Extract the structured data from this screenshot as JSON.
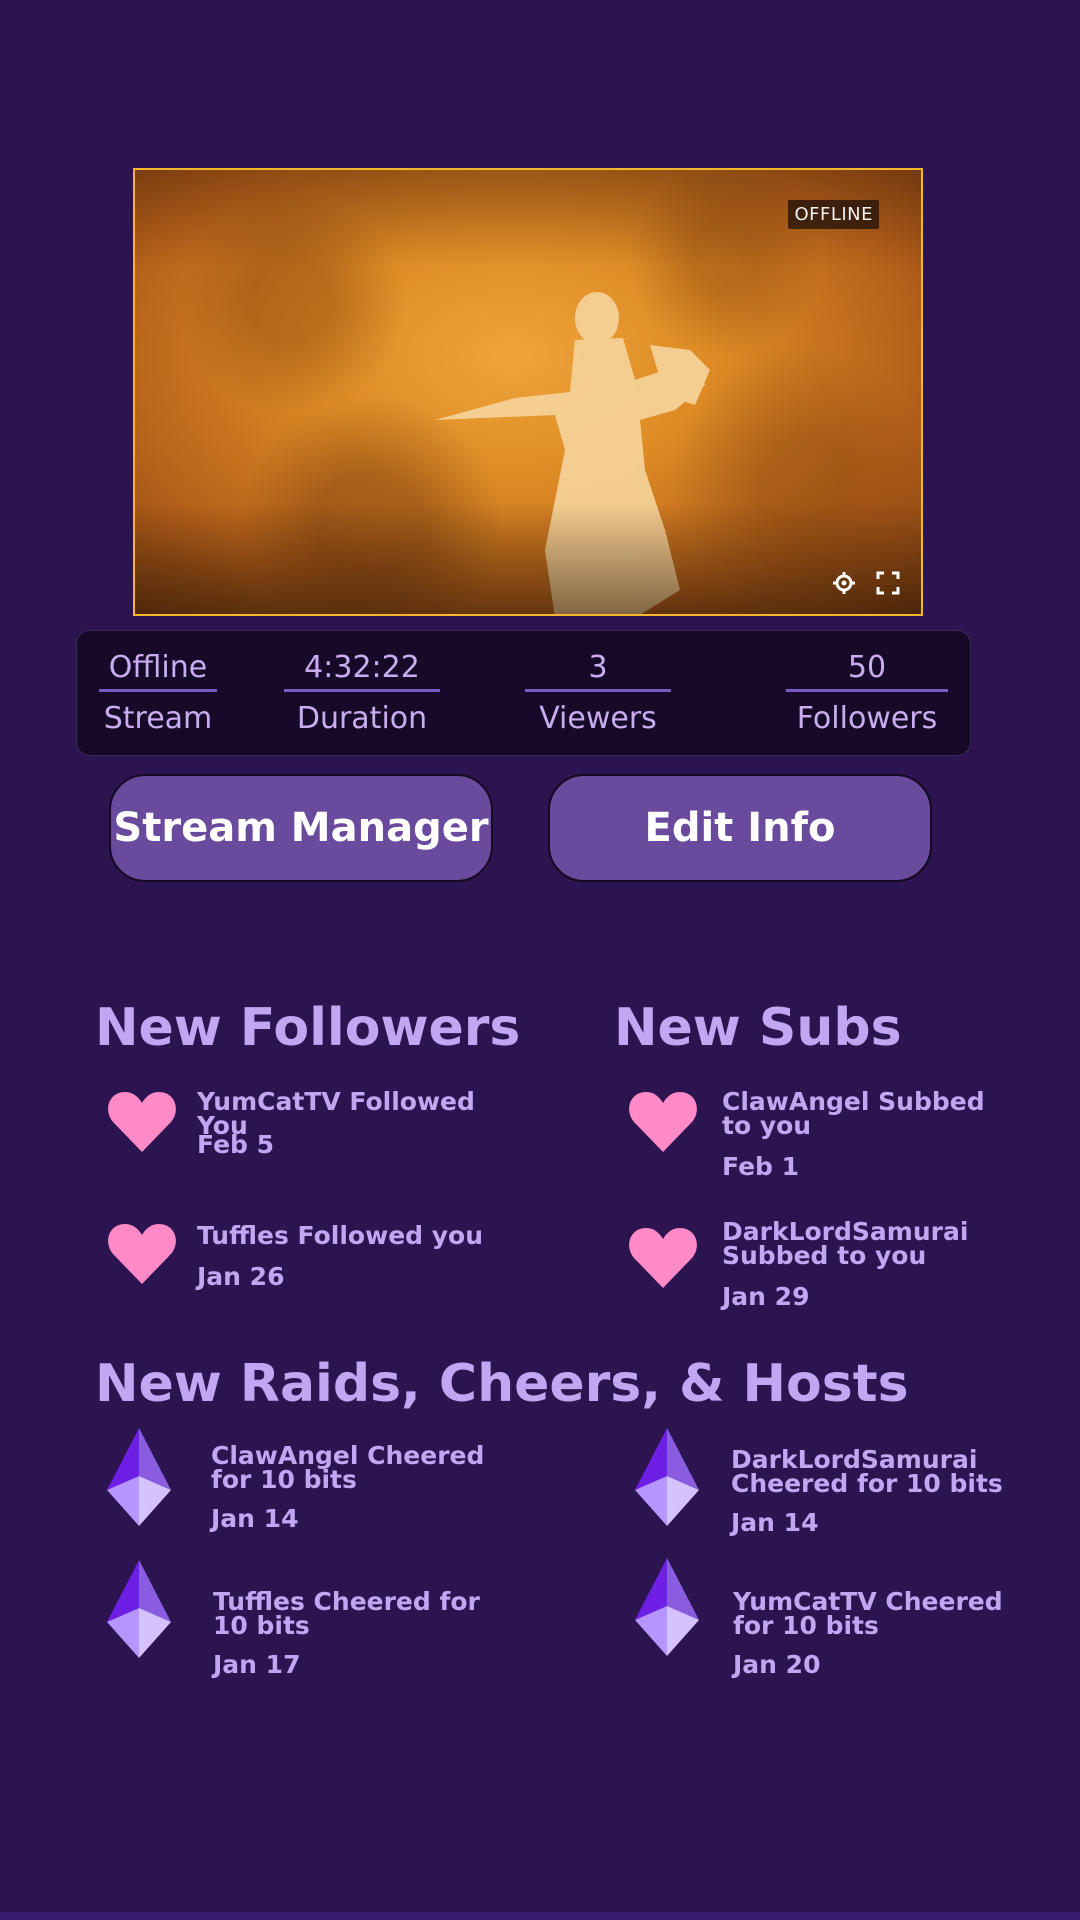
{
  "player": {
    "status_badge": "OFFLINE",
    "icons": [
      "settings-gear-icon",
      "fullscreen-icon"
    ],
    "border_color": "#f2b72a"
  },
  "stats": {
    "stream": {
      "value": "Offline",
      "label": "Stream"
    },
    "duration": {
      "value": "4:32:22",
      "label": "Duration"
    },
    "viewers": {
      "value": "3",
      "label": "Viewers"
    },
    "followers": {
      "value": "50",
      "label": "Followers"
    }
  },
  "buttons": {
    "stream_manager": "Stream Manager",
    "edit_info": "Edit Info"
  },
  "followers": {
    "title": "New Followers",
    "items": [
      {
        "text": "YumCatTV Followed You",
        "date": "Feb 5",
        "icon": "heart-icon"
      },
      {
        "text": "Tuffles Followed you",
        "date": "Jan 26",
        "icon": "heart-icon"
      }
    ]
  },
  "subs": {
    "title": "New Subs",
    "items": [
      {
        "text": "ClawAngel Subbed to you",
        "date": "Feb 1",
        "icon": "heart-icon"
      },
      {
        "text": "DarkLordSamurai Subbed to you",
        "date": "Jan 29",
        "icon": "heart-icon"
      }
    ]
  },
  "raids": {
    "title": "New Raids, Cheers, & Hosts",
    "items": [
      {
        "text": "ClawAngel Cheered for 10 bits",
        "date": "Jan 14",
        "icon": "bits-gem-icon"
      },
      {
        "text": "DarkLordSamurai Cheered for 10 bits",
        "date": "Jan 14",
        "icon": "bits-gem-icon"
      },
      {
        "text": "Tuffles Cheered for 10 bits",
        "date": "Jan 17",
        "icon": "bits-gem-icon"
      },
      {
        "text": "YumCatTV Cheered for 10 bits",
        "date": "Jan 20",
        "icon": "bits-gem-icon"
      }
    ]
  },
  "colors": {
    "background": "#2b1450",
    "accent_text": "#c3a6f2",
    "button": "#6a4a9c",
    "heart": "#ff8ac7",
    "gem_dark": "#6e1fe6",
    "gem_light": "#b795ff"
  }
}
